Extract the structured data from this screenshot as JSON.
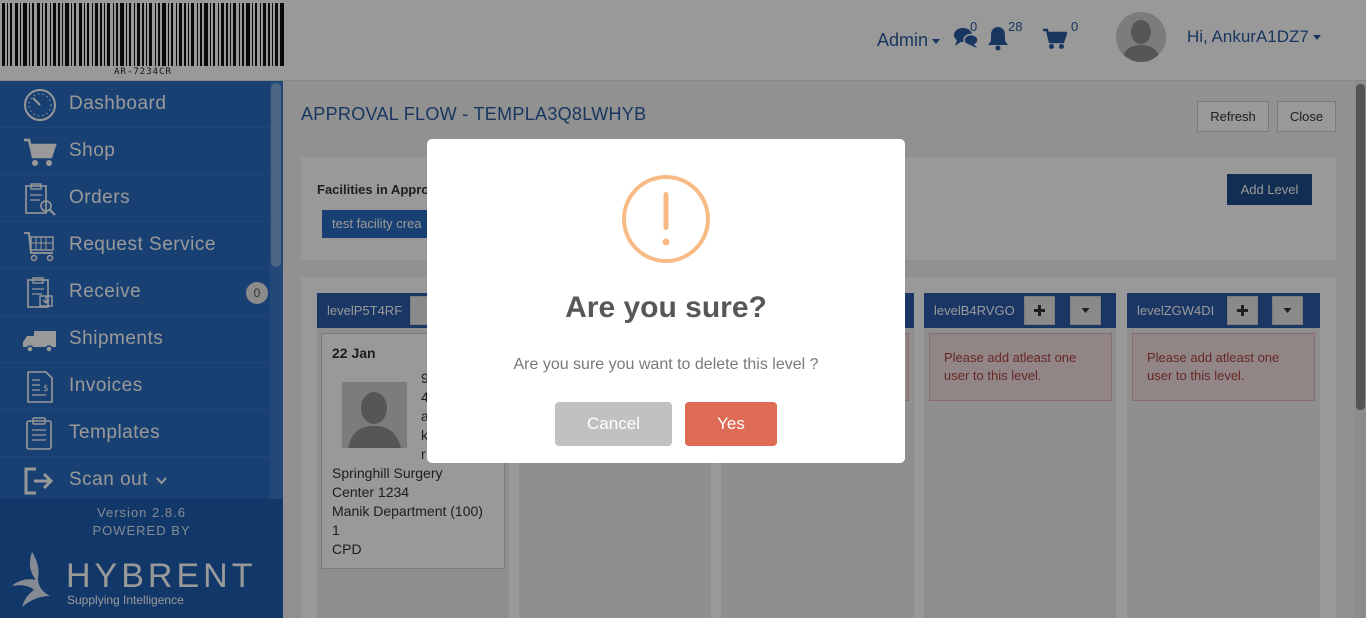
{
  "header": {
    "barcode_text": "AR-7234CR",
    "admin_label": "Admin",
    "messages_count": "0",
    "notifications_count": "28",
    "cart_count": "0",
    "user_greeting": "Hi, AnkurA1DZ7",
    "icons": [
      "chat-icon",
      "bell-icon",
      "cart-icon",
      "avatar"
    ]
  },
  "sidebar": {
    "items": [
      {
        "label": "Dashboard",
        "icon": "dashboard-clock-icon"
      },
      {
        "label": "Shop",
        "icon": "cart-icon"
      },
      {
        "label": "Orders",
        "icon": "clipboard-search-icon"
      },
      {
        "label": "Request Service",
        "icon": "service-cart-icon"
      },
      {
        "label": "Receive",
        "icon": "receive-clipboard-icon",
        "badge": "0"
      },
      {
        "label": "Shipments",
        "icon": "truck-icon"
      },
      {
        "label": "Invoices",
        "icon": "invoice-icon"
      },
      {
        "label": "Templates",
        "icon": "template-icon"
      },
      {
        "label": "Scan out",
        "icon": "scan-out-icon"
      }
    ],
    "version": "Version 2.8.6",
    "powered_by": "POWERED BY",
    "logo_text": "HYBRENT",
    "logo_tagline": "Supplying Intelligence"
  },
  "main": {
    "title": "APPROVAL FLOW - TEMPLA3Q8LWHYB",
    "refresh_label": "Refresh",
    "close_label": "Close",
    "facilities_label": "Facilities in Appro",
    "facility_chip": "test facility crea",
    "add_level_label": "Add Level",
    "levels": [
      {
        "name": "levelP5T4RF"
      },
      {
        "name": "levelB4RVGO",
        "warning": "Please add atleast one user to this level."
      },
      {
        "name": "levelZGW4DI",
        "warning": "Please add atleast one user to this level."
      }
    ],
    "user_card": {
      "date": "22 Jan",
      "fragments": [
        "9",
        "4",
        "a",
        "k",
        "r"
      ],
      "lines": [
        "Springhill Surgery",
        "Center 1234",
        "Manik Department (100)",
        "1",
        "CPD"
      ]
    }
  },
  "modal": {
    "title": "Are you sure?",
    "text": "Are you sure you want to delete this level ?",
    "cancel_label": "Cancel",
    "yes_label": "Yes",
    "icon": "warning-exclamation-icon"
  },
  "colors": {
    "sidebar": "#2a6bbf",
    "sidebar_footer": "#1f5cb0",
    "level_header": "#2a5aa8",
    "accent_text": "#2b5aa0",
    "warning_icon": "#f8bb86",
    "yes_button": "#dd6b55",
    "cancel_button": "#c1c1c1"
  }
}
